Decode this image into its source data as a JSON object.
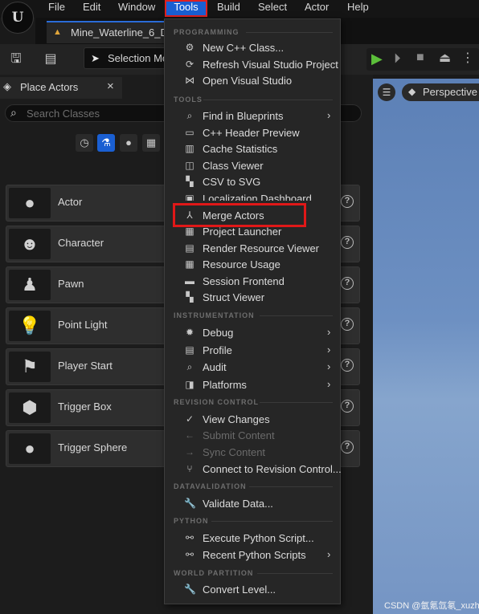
{
  "menubar": {
    "logo": "U",
    "items": [
      "File",
      "Edit",
      "Window",
      "Tools",
      "Build",
      "Select",
      "Actor",
      "Help"
    ]
  },
  "document_tab": {
    "label": "Mine_Waterline_6_D"
  },
  "toolbar": {
    "selection_mode_label": "Selection Mo"
  },
  "place_actors": {
    "title": "Place Actors",
    "search_placeholder": "Search Classes",
    "items": [
      "Actor",
      "Character",
      "Pawn",
      "Point Light",
      "Player Start",
      "Trigger Box",
      "Trigger Sphere"
    ]
  },
  "viewport": {
    "perspective_label": "Perspective"
  },
  "tools_menu": {
    "sections": {
      "programming": "PROGRAMMING",
      "tools": "TOOLS",
      "instrumentation": "INSTRUMENTATION",
      "revision_control": "REVISION CONTROL",
      "datavalidation": "DATAVALIDATION",
      "python": "PYTHON",
      "world_partition": "WORLD PARTITION"
    },
    "programming": [
      "New C++ Class...",
      "Refresh Visual Studio Project",
      "Open Visual Studio"
    ],
    "tools": [
      "Find in Blueprints",
      "C++ Header Preview",
      "Cache Statistics",
      "Class Viewer",
      "CSV to SVG",
      "Localization Dashboard",
      "Merge Actors",
      "Project Launcher",
      "Render Resource Viewer",
      "Resource Usage",
      "Session Frontend",
      "Struct Viewer"
    ],
    "instrumentation": [
      "Debug",
      "Profile",
      "Audit",
      "Platforms"
    ],
    "revision_control": [
      "View Changes",
      "Submit Content",
      "Sync Content",
      "Connect to Revision Control..."
    ],
    "datavalidation": [
      "Validate Data..."
    ],
    "python": [
      "Execute Python Script...",
      "Recent Python Scripts"
    ],
    "world_partition": [
      "Convert Level..."
    ]
  },
  "watermark": "CSDN @氩氪氙氡_xuzhi",
  "colors": {
    "accent": "#1a5fd2",
    "highlight_box": "#e01818",
    "menu_bg": "#262626"
  }
}
